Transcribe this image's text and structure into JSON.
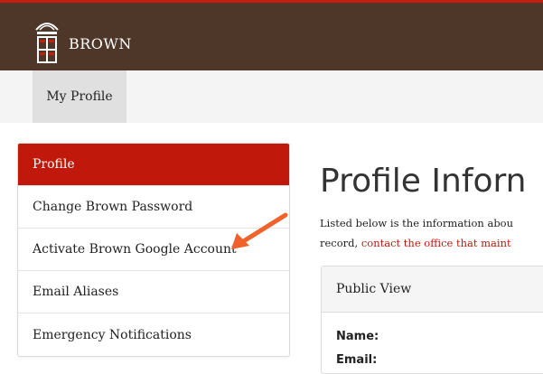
{
  "header": {
    "brand_name": "BROWN"
  },
  "subnav": {
    "tab_label": "My Profile"
  },
  "sidebar": {
    "items": [
      {
        "label": "Profile",
        "active": true
      },
      {
        "label": "Change Brown Password",
        "active": false
      },
      {
        "label": "Activate Brown Google Account",
        "active": false
      },
      {
        "label": "Email Aliases",
        "active": false
      },
      {
        "label": "Emergency Notifications",
        "active": false
      }
    ]
  },
  "main": {
    "title": "Profile Inforn",
    "intro_line1": "Listed below is the information abou",
    "intro_line2_prefix": "record, ",
    "intro_link": "contact the office that maint",
    "panel": {
      "header": "Public View",
      "fields": [
        "Name:",
        "Email:"
      ]
    }
  },
  "colors": {
    "brand_brown": "#4e3629",
    "accent_red": "#c0190b",
    "annotation_arrow": "#f0612b"
  }
}
